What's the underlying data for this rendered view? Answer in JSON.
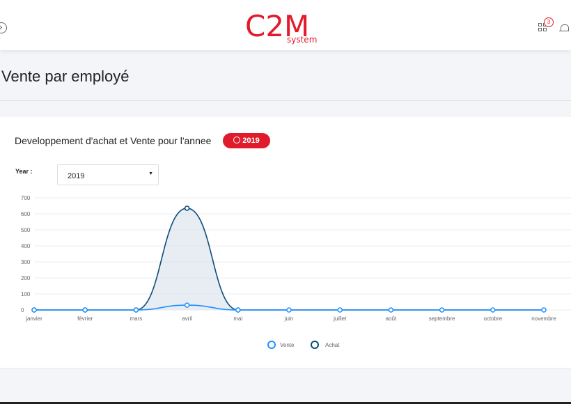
{
  "header": {
    "logo_main": "C2M",
    "logo_sub": "system",
    "notification_count": "3"
  },
  "page": {
    "title": "Vente par employé"
  },
  "card": {
    "title": "Developpement d'achat et Vente pour l'annee",
    "year_badge": "2019",
    "year_label": "Year :",
    "year_select_value": "2019"
  },
  "chart_data": {
    "type": "area",
    "x": [
      "janvier",
      "février",
      "mars",
      "avril",
      "mai",
      "juin",
      "juillet",
      "août",
      "septembre",
      "octobre",
      "novembre"
    ],
    "series": [
      {
        "name": "Vente",
        "values": [
          0,
          0,
          0,
          30,
          0,
          0,
          0,
          0,
          0,
          0,
          0
        ],
        "color": "#1e90ff"
      },
      {
        "name": "Achat",
        "values": [
          0,
          0,
          0,
          635,
          0,
          0,
          0,
          0,
          0,
          0,
          0
        ],
        "color": "#0b4d7a"
      }
    ],
    "y_ticks": [
      0,
      100,
      200,
      300,
      400,
      500,
      600,
      700
    ],
    "ylim": [
      0,
      700
    ],
    "grid": true,
    "legend": "bottom-center"
  }
}
